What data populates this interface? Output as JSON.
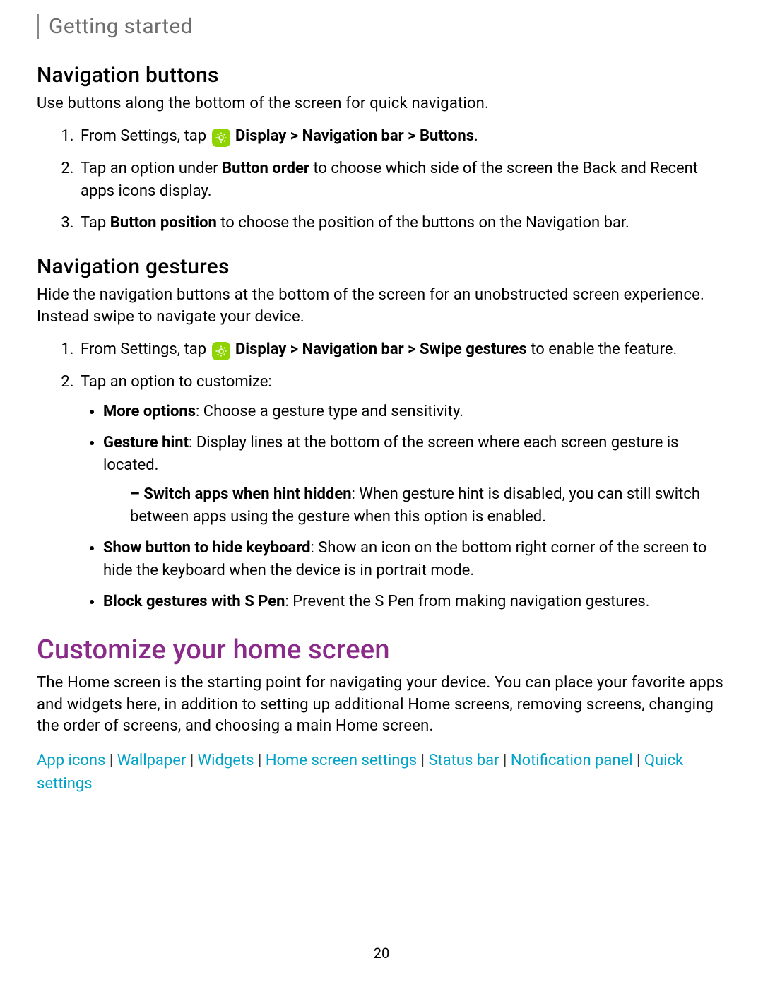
{
  "header": "Getting started",
  "sec1": {
    "title": "Navigation buttons",
    "intro": "Use buttons along the bottom of the screen for quick navigation.",
    "li1a": "From Settings, tap ",
    "li1b": "Display > Navigation bar > Buttons",
    "li1c": ".",
    "li2a": "Tap an option under ",
    "li2b": "Button order",
    "li2c": " to choose which side of the screen the Back and Recent apps icons display.",
    "li3a": "Tap ",
    "li3b": "Button position",
    "li3c": " to choose the position of the buttons on the Navigation bar."
  },
  "sec2": {
    "title": "Navigation gestures",
    "intro": "Hide the navigation buttons at the bottom of the screen for an unobstructed screen experience. Instead swipe to navigate your device.",
    "li1a": "From Settings, tap ",
    "li1b": "Display > Navigation bar > Swipe gestures",
    "li1c": " to enable the feature.",
    "li2": "Tap an option to customize:",
    "b1a": "More options",
    "b1b": ": Choose a gesture type and sensitivity.",
    "b2a": "Gesture hint",
    "b2b": ": Display lines at the bottom of the screen where each screen gesture is located.",
    "b2da": "Switch apps when hint hidden",
    "b2db": ": When gesture hint is disabled, you can still switch between apps using the gesture when this option is enabled.",
    "b3a": "Show button to hide keyboard",
    "b3b": ": Show an icon on the bottom right corner of the screen to hide the keyboard when the device is in portrait mode.",
    "b4a": "Block gestures with S Pen",
    "b4b": ": Prevent the S Pen from making navigation gestures."
  },
  "sec3": {
    "title": "Customize your home screen",
    "intro": "The Home screen is the starting point for navigating your device. You can place your favorite apps and widgets here, in addition to setting up additional Home screens, removing screens, changing the order of screens, and choosing a main Home screen."
  },
  "links": {
    "l1": "App icons",
    "l2": "Wallpaper",
    "l3": "Widgets",
    "l4": "Home screen settings",
    "l5": "Status bar",
    "l6": "Notification panel",
    "l7": "Quick settings",
    "sep": " | "
  },
  "pageNumber": "20"
}
